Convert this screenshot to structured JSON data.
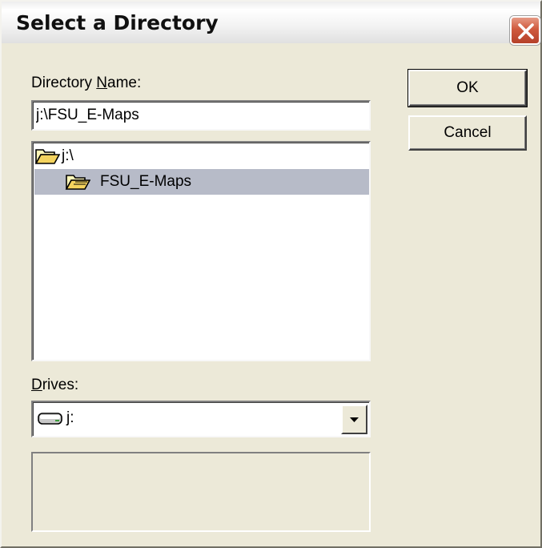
{
  "window": {
    "title": "Select a Directory"
  },
  "directory": {
    "label_prefix": "Directory ",
    "label_accel": "N",
    "label_suffix": "ame:",
    "value": "j:\\FSU_E-Maps"
  },
  "tree": {
    "items": [
      {
        "label": "j:\\",
        "icon": "open-folder-icon",
        "selected": false
      },
      {
        "label": "FSU_E-Maps",
        "icon": "open-folder-icon",
        "selected": true
      }
    ]
  },
  "drives": {
    "label_accel": "D",
    "label_suffix": "rives:",
    "selected": "j:",
    "icon": "drive-icon"
  },
  "buttons": {
    "ok": "OK",
    "cancel": "Cancel"
  },
  "colors": {
    "dialog_bg": "#ece9d8",
    "selection_bg": "#b7bbc8",
    "close_button": "#c8502f"
  }
}
